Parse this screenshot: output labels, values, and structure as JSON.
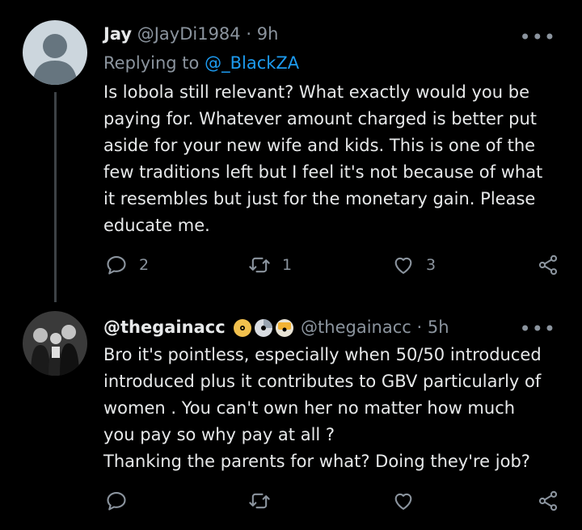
{
  "tweet1": {
    "name": "Jay",
    "handle": "@JayDi1984",
    "separator": "·",
    "time": "9h",
    "more": "•••",
    "replying_prefix": "Replying to ",
    "replying_to": "@_BlackZA",
    "text": "Is lobola still relevant? What exactly would you be\npaying for. Whatever amount charged is better put\naside for your new wife and kids. This is one of the\nfew traditions left but I feel it's not because of what\nit resembles but just for the monetary gain. Please\neducate me.",
    "replies": "2",
    "retweets": "1",
    "likes": "3"
  },
  "tweet2": {
    "name": "@thegainacc",
    "handle": "@thegainacc",
    "separator": "·",
    "time": "5h",
    "more": "•••",
    "text": "Bro it's pointless, especially when 50/50 introduced\nintroduced plus it contributes to GBV particularly of\nwomen . You can't own her no matter how much\nyou pay so why pay at all ?\nThanking the parents for what? Doing they're job?",
    "replies": "",
    "retweets": "",
    "likes": ""
  },
  "colors": {
    "background": "#000000",
    "text": "#e7e9ea",
    "muted": "#8b949e",
    "link": "#1d9bf0"
  },
  "icons": [
    "reply-icon",
    "retweet-icon",
    "like-icon",
    "share-icon",
    "more-icon",
    "cd-badge-icon"
  ]
}
